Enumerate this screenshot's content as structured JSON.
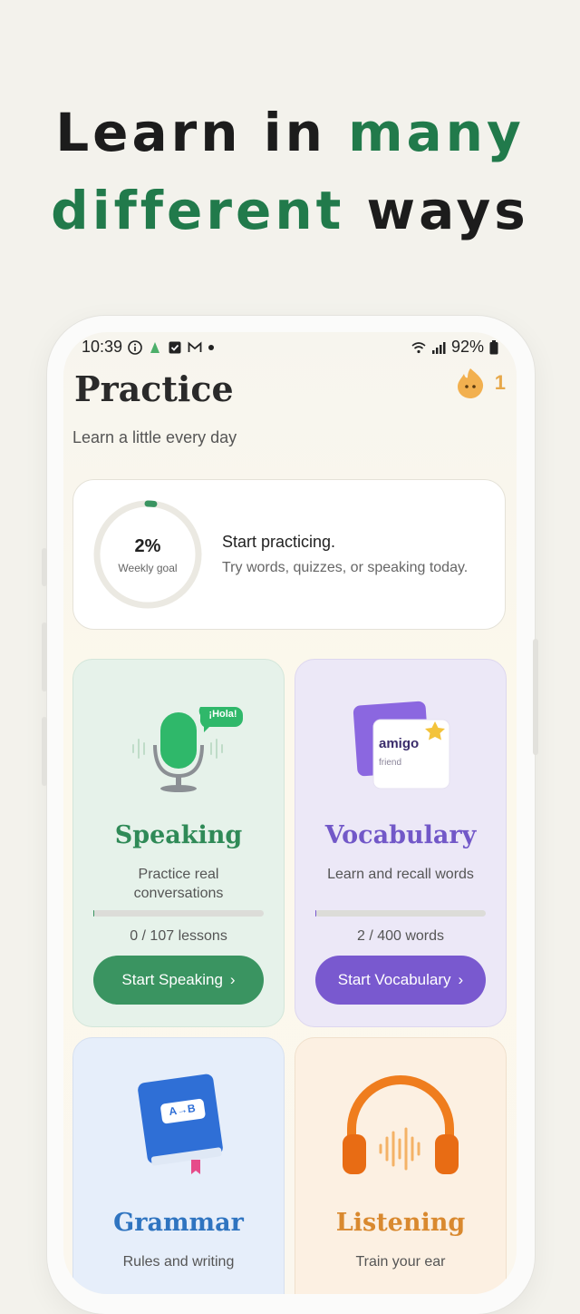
{
  "headline": {
    "line1_plain": "Learn in ",
    "line1_accent": "many",
    "line2_accent": "different",
    "line2_plain": " ways"
  },
  "status_bar": {
    "time": "10:39",
    "battery": "92%",
    "icons": [
      "info-icon",
      "app-icon",
      "check-icon",
      "gmail-icon",
      "dot-icon",
      "wifi-icon",
      "signal-icon",
      "battery-icon"
    ]
  },
  "header": {
    "title": "Practice",
    "subtitle": "Learn a little every day",
    "streak_count": "1"
  },
  "goal": {
    "percent_text": "2%",
    "percent_value": 0.02,
    "label": "Weekly goal",
    "title": "Start practicing.",
    "subtitle": "Try words, quizzes, or speaking today."
  },
  "cards": {
    "speaking": {
      "bubble": "¡Hola!",
      "title": "Speaking",
      "description": "Practice real conversations",
      "count": "0 / 107 lessons",
      "progress": 0.0,
      "button": "Start Speaking"
    },
    "vocabulary": {
      "flashcard_word": "amigo",
      "flashcard_translation": "friend",
      "title": "Vocabulary",
      "description": "Learn and recall words",
      "count": "2 / 400 words",
      "progress": 0.005,
      "button": "Start Vocabulary"
    },
    "grammar": {
      "book_label": "A→B",
      "title": "Grammar",
      "description": "Rules and writing"
    },
    "listening": {
      "title": "Listening",
      "description": "Train your ear"
    }
  },
  "colors": {
    "accent_green": "#217a4b",
    "speaking_green": "#3a9461",
    "vocab_purple": "#7959cf",
    "grammar_blue": "#2f74c0",
    "listening_orange": "#d9892f"
  }
}
